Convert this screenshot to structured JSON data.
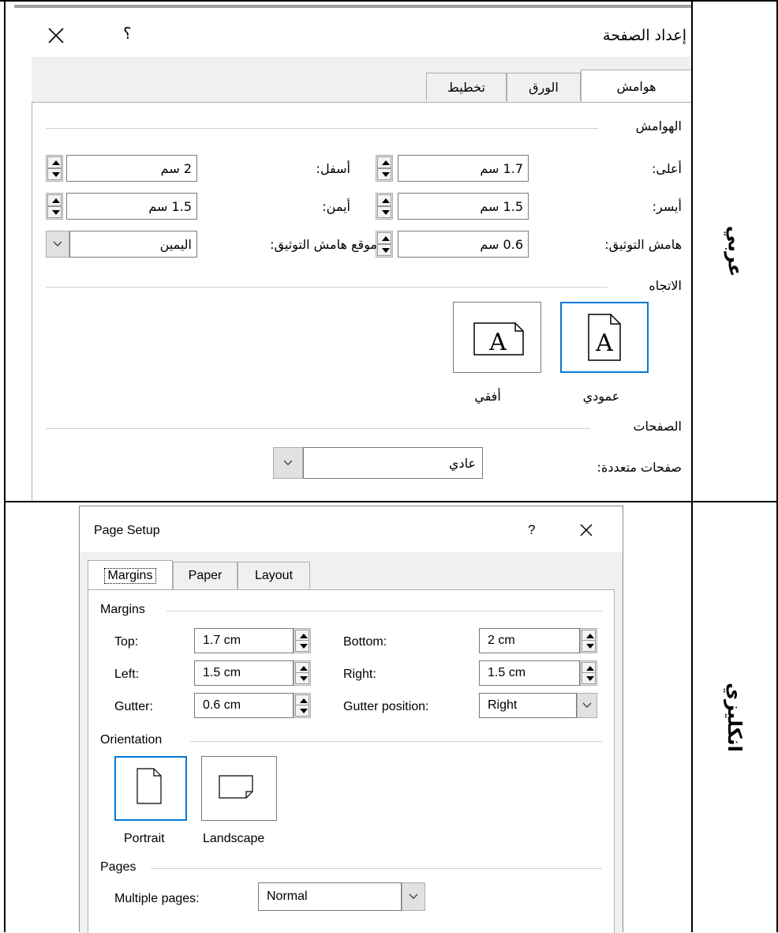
{
  "row_labels": {
    "arabic": "عربي",
    "english": "انكليزي"
  },
  "arabic_dialog": {
    "title": "إعداد الصفحة",
    "help_icon": "؟",
    "tabs": [
      "هوامش",
      "الورق",
      "تخطيط"
    ],
    "margins_group": "الهوامش",
    "top_label": "أعلى:",
    "top_value": "1.7 سم",
    "bottom_label": "أسفل:",
    "bottom_value": "2 سم",
    "left_label": "أيسر:",
    "left_value": "1.5 سم",
    "right_label": "أيمن:",
    "right_value": "1.5 سم",
    "gutter_label": "هامش التوثيق:",
    "gutter_value": "0.6 سم",
    "gutter_pos_label": "موقع هامش التوثيق:",
    "gutter_pos_value": "اليمين",
    "orientation_group": "الاتجاه",
    "portrait": "عمودي",
    "landscape": "أفقي",
    "pages_group": "الصفحات",
    "multiple_pages_label": "صفحات متعددة:",
    "multiple_pages_value": "عادي"
  },
  "english_dialog": {
    "title": "Page Setup",
    "help_icon": "?",
    "tabs": [
      "Margins",
      "Paper",
      "Layout"
    ],
    "margins_group": "Margins",
    "top_label": "Top:",
    "top_value": "1.7 cm",
    "bottom_label": "Bottom:",
    "bottom_value": "2 cm",
    "left_label": "Left:",
    "left_value": "1.5 cm",
    "right_label": "Right:",
    "right_value": "1.5 cm",
    "gutter_label": "Gutter:",
    "gutter_value": "0.6 cm",
    "gutter_pos_label": "Gutter position:",
    "gutter_pos_value": "Right",
    "orientation_group": "Orientation",
    "portrait": "Portrait",
    "landscape": "Landscape",
    "pages_group": "Pages",
    "multiple_pages_label": "Multiple pages:",
    "multiple_pages_value": "Normal"
  },
  "colors": {
    "dialog_bg": "#f0f0f0",
    "selection_blue": "#0078d7",
    "border": "#7a7a7a"
  }
}
